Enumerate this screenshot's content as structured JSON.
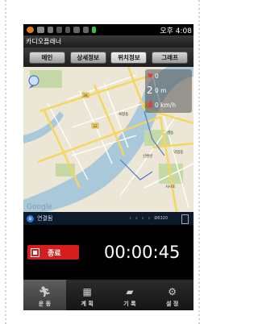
{
  "status_bar": {
    "time": "오후 4:08"
  },
  "app": {
    "title": "카디오플래너"
  },
  "tabs": [
    {
      "label": "메인"
    },
    {
      "label": "상세정보"
    },
    {
      "label": "위치정보"
    },
    {
      "label": "그래프"
    }
  ],
  "map": {
    "labels": {
      "label_1": "36",
      "label_2": "복창동",
      "label_3": "32",
      "label_4": "32",
      "label_5": "성동",
      "label_6": "신환빈",
      "label_7": "익업동",
      "label_8": "사사포",
      "label_9": "Google"
    }
  },
  "stats": {
    "heart_rate": "0",
    "distance": "0 m",
    "speed": "0 km/h"
  },
  "connection": {
    "label": "연결됨",
    "sensor": "D6320"
  },
  "controls": {
    "stop_label": "종료",
    "timer": "00:00:45"
  },
  "bottom_nav": [
    {
      "label": "운 동",
      "icon": "runner-icon"
    },
    {
      "label": "계 획",
      "icon": "calendar-icon"
    },
    {
      "label": "기 록",
      "icon": "briefcase-icon"
    },
    {
      "label": "설 정",
      "icon": "gear-icon"
    }
  ],
  "colors": {
    "accent": "#d51f1f",
    "map_bg": "#ece6d6",
    "river": "#a9c9da"
  }
}
